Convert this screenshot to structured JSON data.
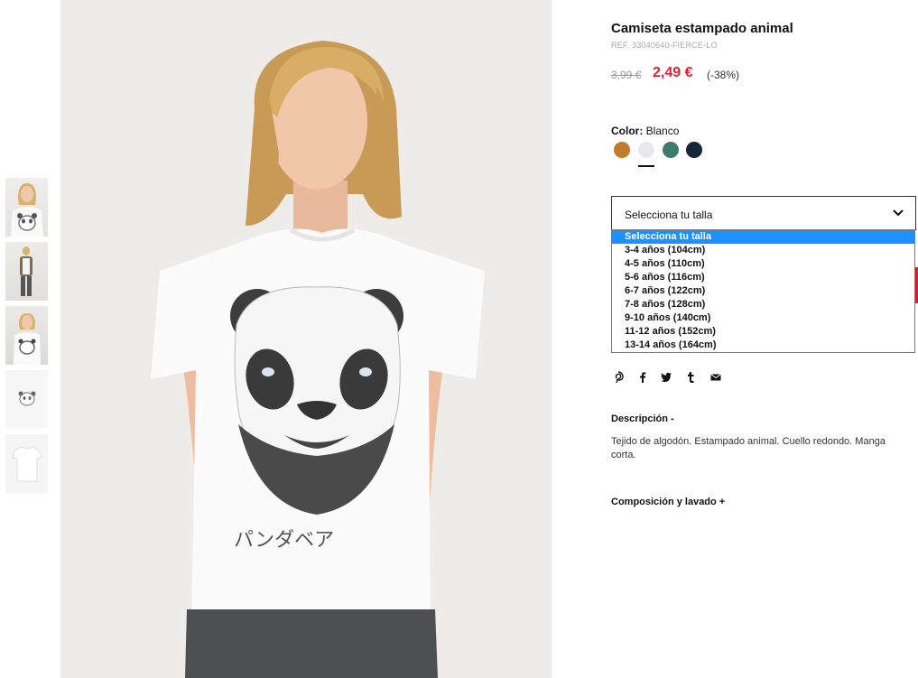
{
  "product": {
    "title": "Camiseta estampado animal",
    "ref": "REF. 33040640-FIERCE-LO",
    "price_old": "3,99 €",
    "price_new": "2,49 €",
    "discount": "(-38%)"
  },
  "color": {
    "label": "Color:",
    "selected": "Blanco",
    "swatches": [
      "#c47a2c",
      "#e8e8ec",
      "#3e7a6e",
      "#18263a"
    ]
  },
  "size_select": {
    "current": "Selecciona tu talla",
    "options": [
      "Selecciona tu talla",
      "3-4 años (104cm)",
      "4-5 años (110cm)",
      "5-6 años (116cm)",
      "6-7 años (122cm)",
      "7-8 años (128cm)",
      "9-10 años (140cm)",
      "11-12 años (152cm)",
      "13-14 años (164cm)"
    ]
  },
  "share_icons": [
    "pinterest-icon",
    "facebook-icon",
    "twitter-icon",
    "tumblr-icon",
    "email-icon"
  ],
  "description": {
    "title": "Descripción -",
    "text": "Tejido de algodón. Estampado animal. Cuello redondo. Manga corta."
  },
  "composition": {
    "title": "Composición y lavado +"
  },
  "image_text": {
    "katakana": "パンダベア"
  },
  "colors": {
    "price_red": "#e0202f",
    "selected_option": "#1e90ff"
  }
}
